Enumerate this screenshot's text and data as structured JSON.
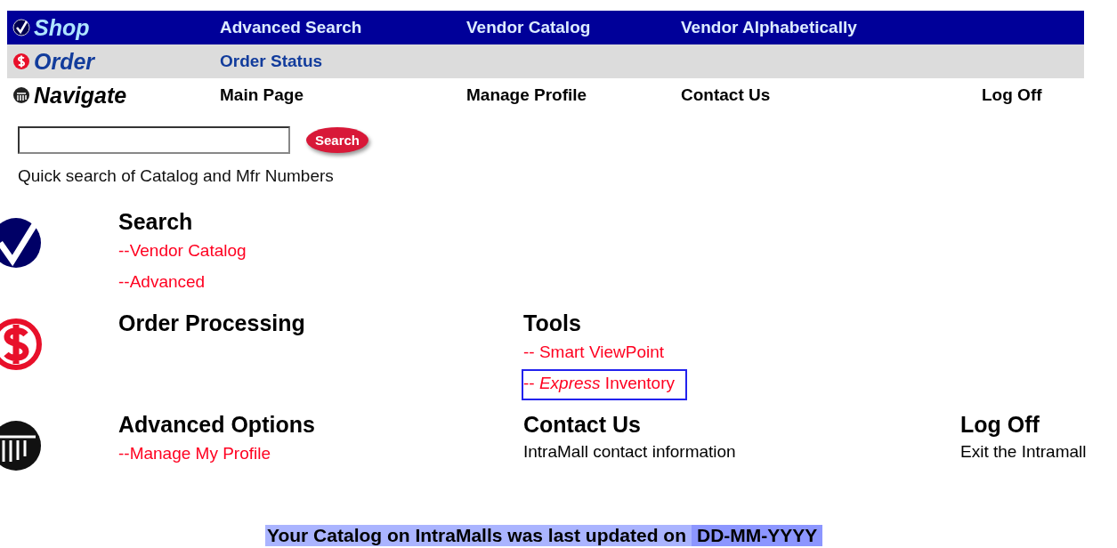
{
  "nav": [
    {
      "title": "Shop",
      "links": [
        "Advanced Search",
        "Vendor Catalog",
        "Vendor Alphabetically"
      ]
    },
    {
      "title": "Order",
      "links": [
        "Order Status"
      ]
    },
    {
      "title": "Navigate",
      "links": [
        "Main Page",
        "Manage Profile",
        "Contact Us",
        "Log Off"
      ]
    }
  ],
  "quick_search": {
    "button": "Search",
    "hint": "Quick search of Catalog and Mfr Numbers"
  },
  "sections": [
    {
      "cells": [
        {
          "title": "Search",
          "items": [
            {
              "kind": "link",
              "text": "--Vendor Catalog",
              "focused": false
            },
            {
              "kind": "link",
              "text": "--Advanced",
              "focused": false
            }
          ]
        }
      ]
    },
    {
      "cells": [
        {
          "title": "Order Processing"
        },
        {
          "title": "Tools",
          "items": [
            {
              "kind": "link",
              "text": "-- Smart ViewPoint",
              "focused": false
            },
            {
              "kind": "link",
              "text": "-- *Express* Inventory",
              "focused": true
            }
          ]
        }
      ]
    },
    {
      "cells": [
        {
          "title": "Advanced Options",
          "items": [
            {
              "kind": "link",
              "text": "--Manage My Profile",
              "focused": false
            }
          ]
        },
        {
          "title": "Contact Us",
          "items": [
            {
              "kind": "text",
              "text": "IntraMall contact information"
            }
          ]
        },
        {
          "title": "Log Off",
          "items": [
            {
              "kind": "text",
              "text": "Exit the Intramall"
            }
          ]
        }
      ]
    }
  ],
  "footer": {
    "text": "Your Catalog on IntraMalls was last updated on",
    "date": "DD-MM-YYYY"
  }
}
